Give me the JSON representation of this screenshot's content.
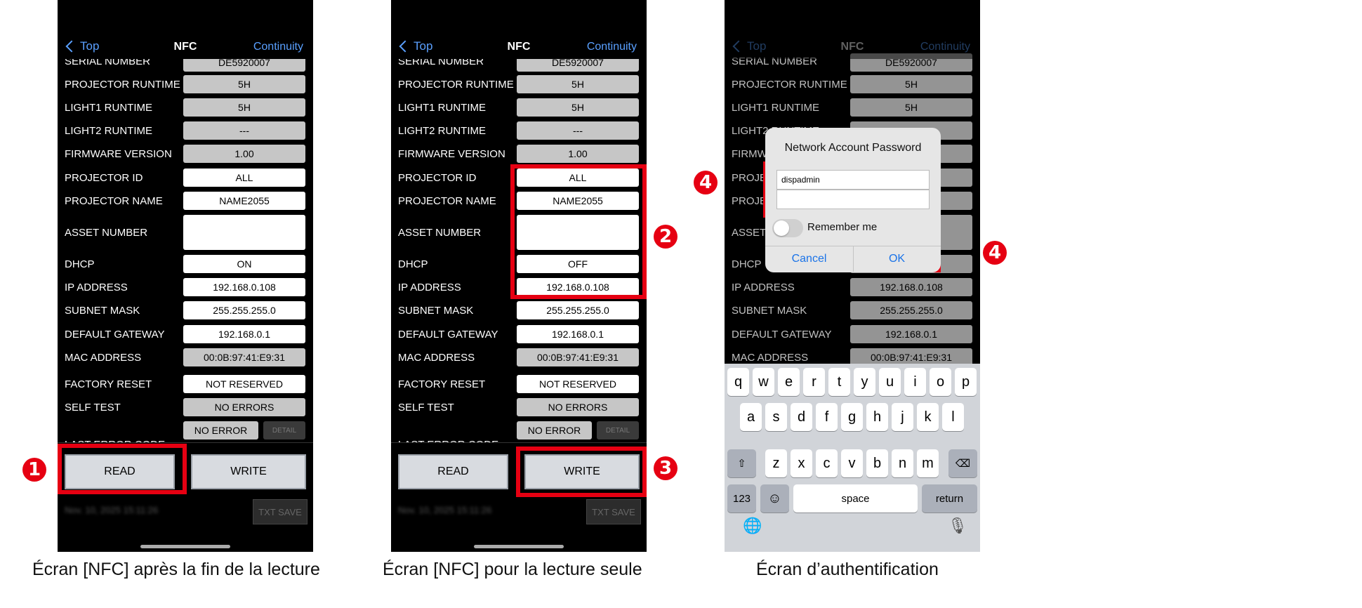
{
  "nav": {
    "back": "Top",
    "title": "NFC",
    "continuity": "Continuity"
  },
  "rows": {
    "serial": "SERIAL NUMBER",
    "serial_val": "DE5920007",
    "runtime": "PROJECTOR RUNTIME",
    "runtime_val": "5H",
    "light1": "LIGHT1 RUNTIME",
    "light1_val": "5H",
    "light2": "LIGHT2 RUNTIME",
    "light2_val": "---",
    "firmware": "FIRMWARE VERSION",
    "firmware_val": "1.00",
    "pid": "PROJECTOR ID",
    "pid_val": "ALL",
    "pname": "PROJECTOR NAME",
    "pname_val": "NAME2055",
    "asset": "ASSET NUMBER",
    "dhcp": "DHCP",
    "dhcp_on": "ON",
    "dhcp_off": "OFF",
    "ip": "IP ADDRESS",
    "ip_val": "192.168.0.108",
    "subnet": "SUBNET MASK",
    "subnet_val": "255.255.255.0",
    "gateway": "DEFAULT GATEWAY",
    "gateway_val": "192.168.0.1",
    "mac": "MAC ADDRESS",
    "mac_val": "00:0B:97:41:E9:31",
    "factory": "FACTORY RESET",
    "factory_val": "NOT RESERVED",
    "selftest": "SELF TEST",
    "selftest_val": "NO ERRORS",
    "lasterr": "LAST ERROR CODE",
    "lasterr_val": "NO ERROR",
    "detail": "DETAIL"
  },
  "buttons": {
    "read": "READ",
    "write": "WRITE",
    "txtsave": "TXT SAVE"
  },
  "timestamp": "Nov. 10, 2025 15:11:26",
  "dialog": {
    "title": "Network Account Password",
    "user": "dispadmin",
    "password": "",
    "remember": "Remember me",
    "cancel": "Cancel",
    "ok": "OK"
  },
  "keyboard": {
    "row1": [
      "q",
      "w",
      "e",
      "r",
      "t",
      "y",
      "u",
      "i",
      "o",
      "p"
    ],
    "row2": [
      "a",
      "s",
      "d",
      "f",
      "g",
      "h",
      "j",
      "k",
      "l"
    ],
    "row3": [
      "z",
      "x",
      "c",
      "v",
      "b",
      "n",
      "m"
    ],
    "shift": "⇧",
    "backspace": "⌫",
    "numbers": "123",
    "emoji": "☺",
    "space": "space",
    "return": "return",
    "globe": "🌐",
    "mic": "🎙"
  },
  "markers": {
    "m1": "1",
    "m2": "2",
    "m3": "3",
    "m4": "4"
  },
  "captions": {
    "c1": "Écran [NFC] après la fin de la lecture",
    "c2": "Écran [NFC] pour la lecture seule",
    "c3": "Écran d’authentification"
  },
  "colors": {
    "accent_blue": "#5aa0ff",
    "highlight_red": "#e60012"
  }
}
